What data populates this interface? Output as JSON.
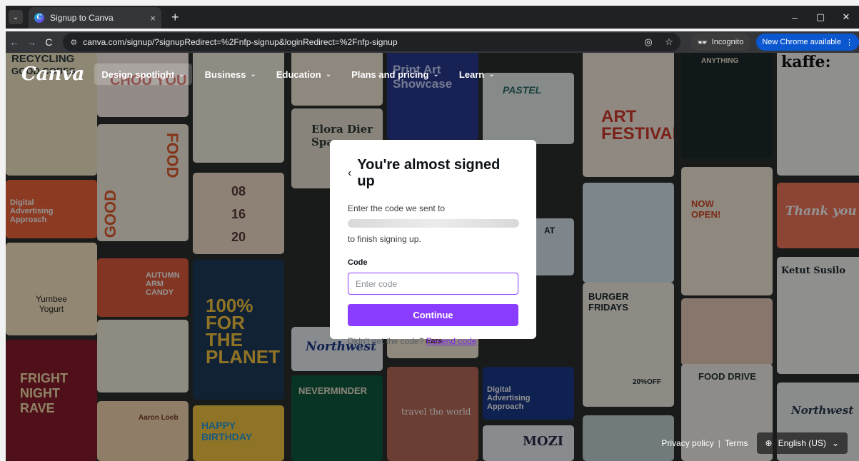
{
  "browser": {
    "tab_title": "Signup to Canva",
    "favicon_letter": "C",
    "close_glyph": "×",
    "new_tab_glyph": "+",
    "url": "canva.com/signup/?signupRedirect=%2Fnfp-signup&loginRedirect=%2Fnfp-signup",
    "incognito_label": "Incognito",
    "new_chrome_label": "New Chrome available",
    "more_glyph": "⋮",
    "back_glyph": "←",
    "forward_glyph": "→",
    "reload_glyph": "C",
    "window_min": "–",
    "window_restore": "▢",
    "window_close": "✕"
  },
  "nav": {
    "logo": "Canva",
    "items": [
      {
        "label": "Design spotlight",
        "active": true
      },
      {
        "label": "Business"
      },
      {
        "label": "Education"
      },
      {
        "label": "Plans and pricing"
      },
      {
        "label": "Learn"
      }
    ],
    "chevron": "⌄"
  },
  "collage": {
    "texts": [
      "RECYCLING",
      "GOOD CODES",
      "CHOU YOU",
      "FOOD",
      "GOOD",
      "Digital Advertising Approach",
      "Yumbee Yogurt",
      "AUTUMN ARM CANDY",
      "FRIGHT NIGHT RAVE",
      "Aaron Loeb",
      "08",
      "16",
      "20",
      "HAPPY BIRTHDAY",
      "100% FOR THE PLANET",
      "Elora Dier Spa",
      "Northwest",
      "Eats",
      "NEVERMINDER",
      "travel the world",
      "Print Art Showcase",
      "PASTEL",
      "AT",
      "Digital Advertising Approach",
      "MOZI",
      "ART FESTIVAL",
      "BURGER FRIDAYS",
      "20%OFF",
      "NOW OPEN!",
      "FOOD DRIVE",
      "ANYTHING",
      "kaffe:",
      "Thank you",
      "Ketut Susilo",
      "Northwest"
    ]
  },
  "modal": {
    "back_glyph": "‹",
    "title": "You're almost signed up",
    "line1": "Enter the code we sent to",
    "line2": "to finish signing up.",
    "code_label": "Code",
    "code_placeholder": "Enter code",
    "continue_label": "Continue",
    "resend_prompt": "Didn't get the code?",
    "resend_link": "Resend code"
  },
  "footer": {
    "privacy": "Privacy policy",
    "separator": "|",
    "terms": "Terms",
    "language": "English (US)",
    "globe_glyph": "⊕",
    "chevron": "⌄"
  },
  "colors": {
    "accent": "#8b3dff",
    "link": "#7d2ae8",
    "chrome_dark": "#202124",
    "new_chrome_blue": "#0b57d0"
  }
}
